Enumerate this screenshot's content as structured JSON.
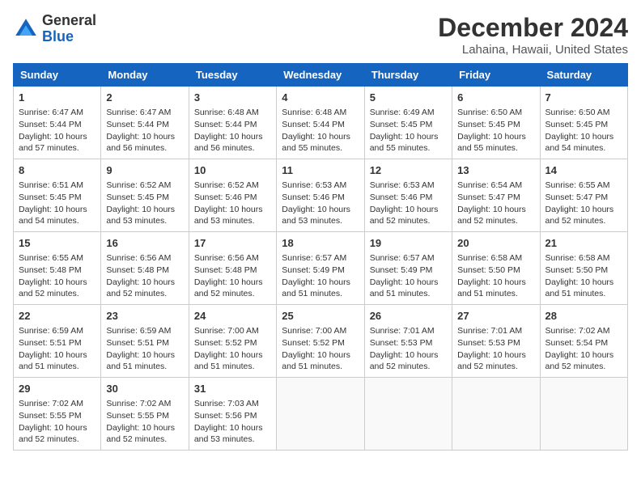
{
  "header": {
    "logo_line1": "General",
    "logo_line2": "Blue",
    "month": "December 2024",
    "location": "Lahaina, Hawaii, United States"
  },
  "weekdays": [
    "Sunday",
    "Monday",
    "Tuesday",
    "Wednesday",
    "Thursday",
    "Friday",
    "Saturday"
  ],
  "weeks": [
    [
      {
        "day": "1",
        "info": "Sunrise: 6:47 AM\nSunset: 5:44 PM\nDaylight: 10 hours\nand 57 minutes."
      },
      {
        "day": "2",
        "info": "Sunrise: 6:47 AM\nSunset: 5:44 PM\nDaylight: 10 hours\nand 56 minutes."
      },
      {
        "day": "3",
        "info": "Sunrise: 6:48 AM\nSunset: 5:44 PM\nDaylight: 10 hours\nand 56 minutes."
      },
      {
        "day": "4",
        "info": "Sunrise: 6:48 AM\nSunset: 5:44 PM\nDaylight: 10 hours\nand 55 minutes."
      },
      {
        "day": "5",
        "info": "Sunrise: 6:49 AM\nSunset: 5:45 PM\nDaylight: 10 hours\nand 55 minutes."
      },
      {
        "day": "6",
        "info": "Sunrise: 6:50 AM\nSunset: 5:45 PM\nDaylight: 10 hours\nand 55 minutes."
      },
      {
        "day": "7",
        "info": "Sunrise: 6:50 AM\nSunset: 5:45 PM\nDaylight: 10 hours\nand 54 minutes."
      }
    ],
    [
      {
        "day": "8",
        "info": "Sunrise: 6:51 AM\nSunset: 5:45 PM\nDaylight: 10 hours\nand 54 minutes."
      },
      {
        "day": "9",
        "info": "Sunrise: 6:52 AM\nSunset: 5:45 PM\nDaylight: 10 hours\nand 53 minutes."
      },
      {
        "day": "10",
        "info": "Sunrise: 6:52 AM\nSunset: 5:46 PM\nDaylight: 10 hours\nand 53 minutes."
      },
      {
        "day": "11",
        "info": "Sunrise: 6:53 AM\nSunset: 5:46 PM\nDaylight: 10 hours\nand 53 minutes."
      },
      {
        "day": "12",
        "info": "Sunrise: 6:53 AM\nSunset: 5:46 PM\nDaylight: 10 hours\nand 52 minutes."
      },
      {
        "day": "13",
        "info": "Sunrise: 6:54 AM\nSunset: 5:47 PM\nDaylight: 10 hours\nand 52 minutes."
      },
      {
        "day": "14",
        "info": "Sunrise: 6:55 AM\nSunset: 5:47 PM\nDaylight: 10 hours\nand 52 minutes."
      }
    ],
    [
      {
        "day": "15",
        "info": "Sunrise: 6:55 AM\nSunset: 5:48 PM\nDaylight: 10 hours\nand 52 minutes."
      },
      {
        "day": "16",
        "info": "Sunrise: 6:56 AM\nSunset: 5:48 PM\nDaylight: 10 hours\nand 52 minutes."
      },
      {
        "day": "17",
        "info": "Sunrise: 6:56 AM\nSunset: 5:48 PM\nDaylight: 10 hours\nand 52 minutes."
      },
      {
        "day": "18",
        "info": "Sunrise: 6:57 AM\nSunset: 5:49 PM\nDaylight: 10 hours\nand 51 minutes."
      },
      {
        "day": "19",
        "info": "Sunrise: 6:57 AM\nSunset: 5:49 PM\nDaylight: 10 hours\nand 51 minutes."
      },
      {
        "day": "20",
        "info": "Sunrise: 6:58 AM\nSunset: 5:50 PM\nDaylight: 10 hours\nand 51 minutes."
      },
      {
        "day": "21",
        "info": "Sunrise: 6:58 AM\nSunset: 5:50 PM\nDaylight: 10 hours\nand 51 minutes."
      }
    ],
    [
      {
        "day": "22",
        "info": "Sunrise: 6:59 AM\nSunset: 5:51 PM\nDaylight: 10 hours\nand 51 minutes."
      },
      {
        "day": "23",
        "info": "Sunrise: 6:59 AM\nSunset: 5:51 PM\nDaylight: 10 hours\nand 51 minutes."
      },
      {
        "day": "24",
        "info": "Sunrise: 7:00 AM\nSunset: 5:52 PM\nDaylight: 10 hours\nand 51 minutes."
      },
      {
        "day": "25",
        "info": "Sunrise: 7:00 AM\nSunset: 5:52 PM\nDaylight: 10 hours\nand 51 minutes."
      },
      {
        "day": "26",
        "info": "Sunrise: 7:01 AM\nSunset: 5:53 PM\nDaylight: 10 hours\nand 52 minutes."
      },
      {
        "day": "27",
        "info": "Sunrise: 7:01 AM\nSunset: 5:53 PM\nDaylight: 10 hours\nand 52 minutes."
      },
      {
        "day": "28",
        "info": "Sunrise: 7:02 AM\nSunset: 5:54 PM\nDaylight: 10 hours\nand 52 minutes."
      }
    ],
    [
      {
        "day": "29",
        "info": "Sunrise: 7:02 AM\nSunset: 5:55 PM\nDaylight: 10 hours\nand 52 minutes."
      },
      {
        "day": "30",
        "info": "Sunrise: 7:02 AM\nSunset: 5:55 PM\nDaylight: 10 hours\nand 52 minutes."
      },
      {
        "day": "31",
        "info": "Sunrise: 7:03 AM\nSunset: 5:56 PM\nDaylight: 10 hours\nand 53 minutes."
      },
      {
        "day": "",
        "info": ""
      },
      {
        "day": "",
        "info": ""
      },
      {
        "day": "",
        "info": ""
      },
      {
        "day": "",
        "info": ""
      }
    ]
  ]
}
